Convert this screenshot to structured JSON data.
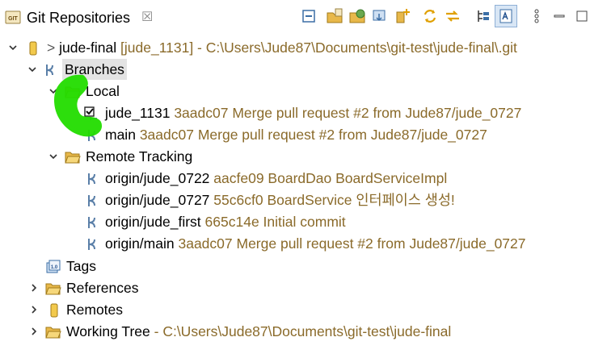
{
  "view": {
    "tab_title": "Git Repositories",
    "close_glyph": "☒"
  },
  "tree": {
    "repo": {
      "prefix": ">",
      "name": "jude-final",
      "decoration": "[jude_1131] - C:\\Users\\Jude87\\Documents\\git-test\\jude-final\\.git"
    },
    "branches_label": "Branches",
    "local_label": "Local",
    "local_branches": [
      {
        "name": "jude_1131",
        "commit": "3aadc07 Merge pull request #2 from Jude87/jude_0727"
      },
      {
        "name": "main",
        "commit": "3aadc07 Merge pull request #2 from Jude87/jude_0727"
      }
    ],
    "remote_label": "Remote Tracking",
    "remote_branches": [
      {
        "name": "origin/jude_0722",
        "commit": "aacfe09 BoardDao BoardServiceImpl"
      },
      {
        "name": "origin/jude_0727",
        "commit": "55c6cf0 BoardService 인터페이스 생성!"
      },
      {
        "name": "origin/jude_first",
        "commit": "665c14e Initial commit"
      },
      {
        "name": "origin/main",
        "commit": "3aadc07 Merge pull request #2 from Jude87/jude_0727"
      }
    ],
    "tags_label": "Tags",
    "references_label": "References",
    "remotes_label": "Remotes",
    "working_tree": {
      "label": "Working Tree",
      "decoration": "- C:\\Users\\Jude87\\Documents\\git-test\\jude-final"
    }
  },
  "colors": {
    "decoration": "#8a6a2a",
    "annotation": "#22dd00",
    "folder": "#e8b84a",
    "branch_icon": "#5a7fa8"
  }
}
